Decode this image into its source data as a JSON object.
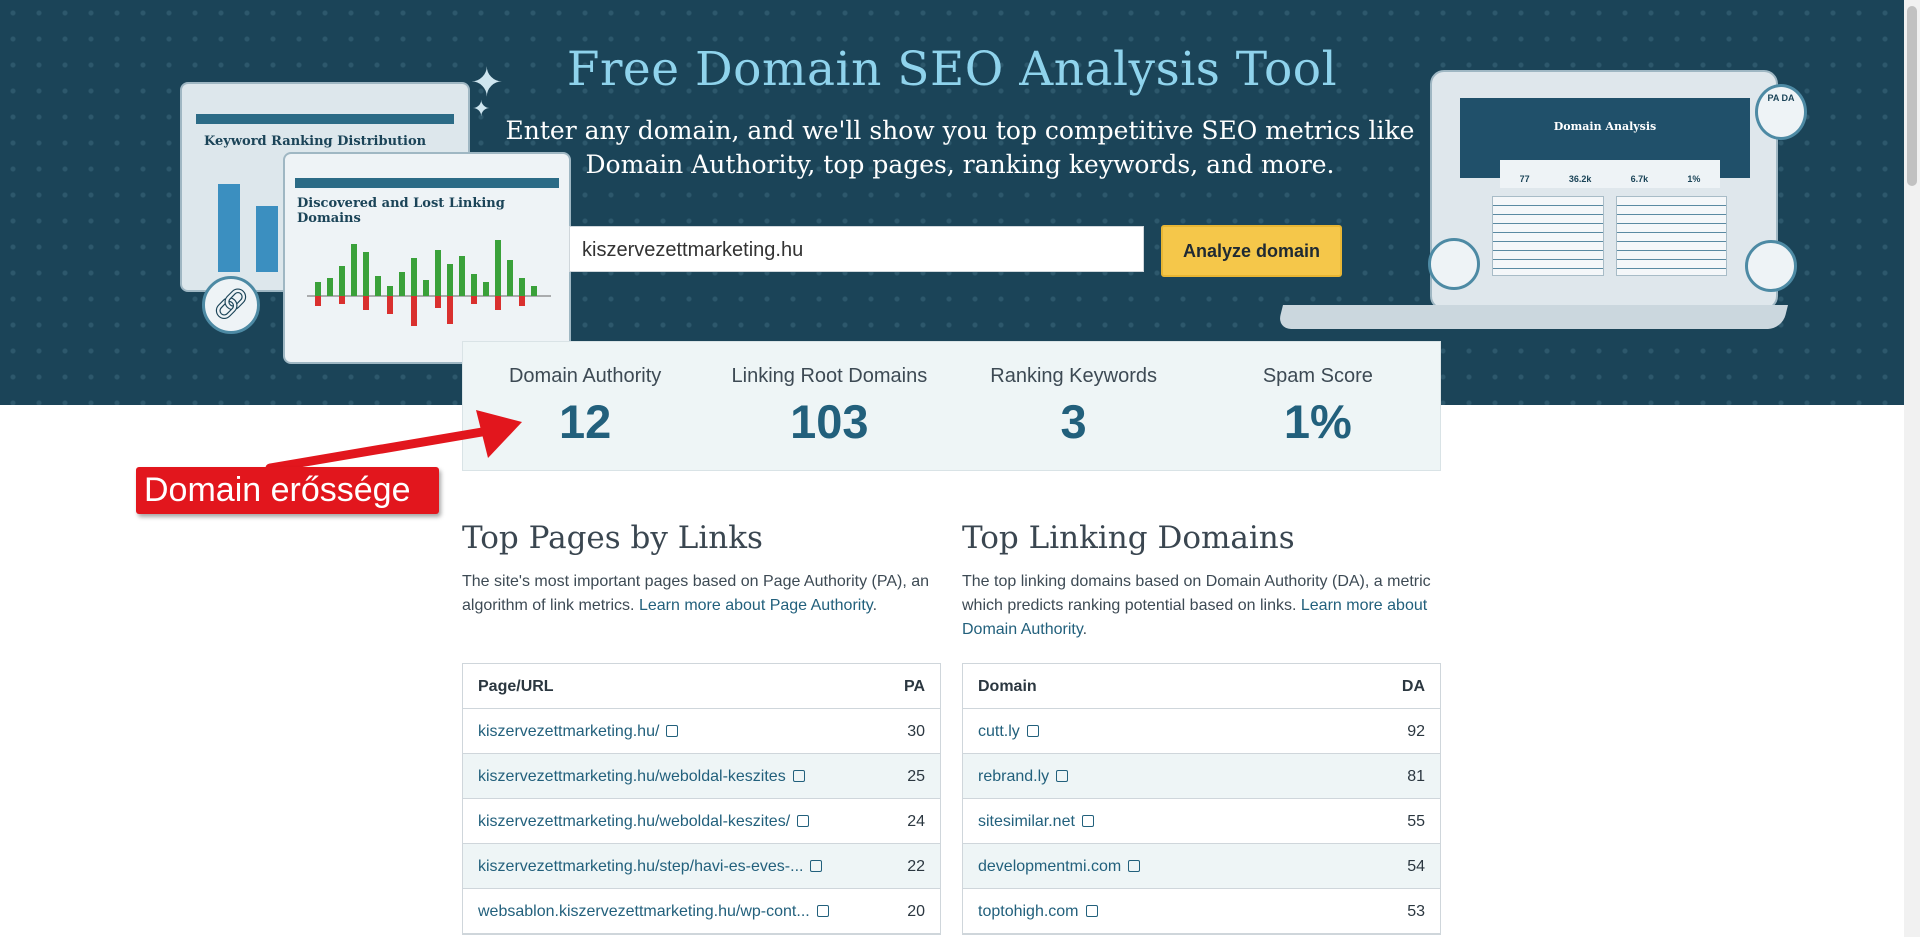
{
  "hero": {
    "title": "Free Domain SEO Analysis Tool",
    "subtitle_line1": "Enter any domain, and we'll show you top competitive SEO metrics like",
    "subtitle_line2": "Domain Authority, top pages, ranking keywords, and more.",
    "search_value": "kiszervezettmarketing.hu",
    "analyze_label": "Analyze domain",
    "illus_card1_title": "Keyword Ranking Distribution",
    "illus_card2_title": "Discovered and Lost Linking Domains",
    "illus_laptop_title": "Domain Analysis",
    "illus_laptop_metrics": [
      "77",
      "36.2k",
      "6.7k",
      "1%"
    ],
    "illus_pa": "PA",
    "illus_da": "DA",
    "colors": {
      "bg": "#1b4458",
      "title": "#8fd3ec",
      "button": "#f5c74a"
    }
  },
  "metrics": [
    {
      "label": "Domain Authority",
      "value": "12"
    },
    {
      "label": "Linking Root Domains",
      "value": "103"
    },
    {
      "label": "Ranking Keywords",
      "value": "3"
    },
    {
      "label": "Spam Score",
      "value": "1%"
    }
  ],
  "annotation": {
    "text": "Domain erőssége",
    "color": "#e2161d"
  },
  "top_pages": {
    "title": "Top Pages by Links",
    "desc": "The site's most important pages based on Page Authority (PA), an algorithm of link metrics.",
    "link": "Learn more about Page Authority",
    "col_url": "Page/URL",
    "col_metric": "PA",
    "rows": [
      {
        "url": "kiszervezettmarketing.hu/",
        "value": "30"
      },
      {
        "url": "kiszervezettmarketing.hu/weboldal-keszites",
        "value": "25"
      },
      {
        "url": "kiszervezettmarketing.hu/weboldal-keszites/",
        "value": "24"
      },
      {
        "url": "kiszervezettmarketing.hu/step/havi-es-eves-...",
        "value": "22"
      },
      {
        "url": "websablon.kiszervezettmarketing.hu/wp-cont...",
        "value": "20"
      }
    ]
  },
  "top_domains": {
    "title": "Top Linking Domains",
    "desc": "The top linking domains based on Domain Authority (DA), a metric which predicts ranking potential based on links.",
    "link": "Learn more about Domain Authority",
    "col_url": "Domain",
    "col_metric": "DA",
    "rows": [
      {
        "url": "cutt.ly",
        "value": "92"
      },
      {
        "url": "rebrand.ly",
        "value": "81"
      },
      {
        "url": "sitesimilar.net",
        "value": "55"
      },
      {
        "url": "developmentmi.com",
        "value": "54"
      },
      {
        "url": "toptohigh.com",
        "value": "53"
      }
    ]
  }
}
